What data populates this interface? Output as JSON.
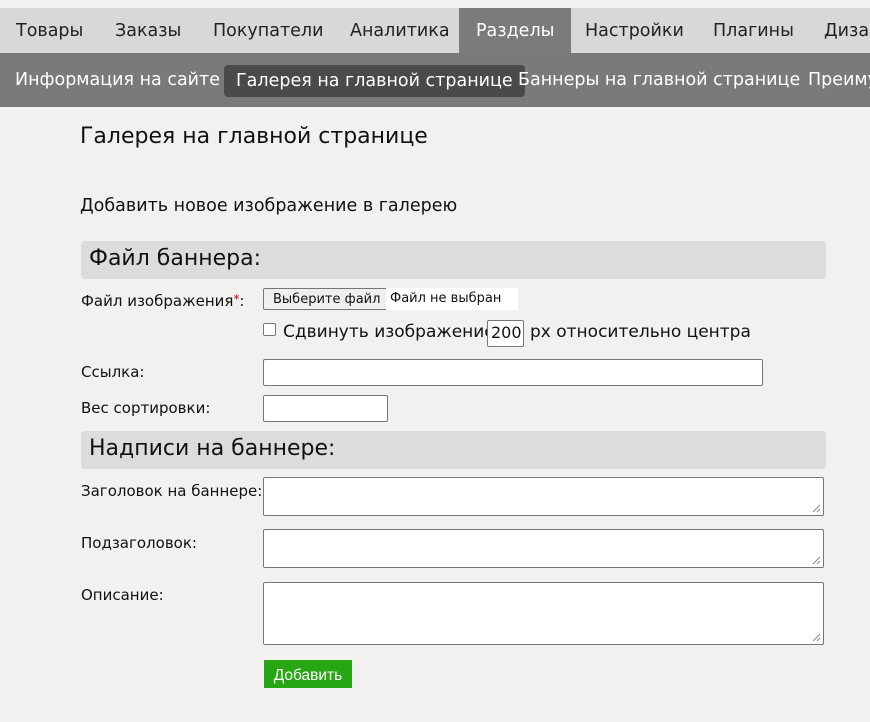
{
  "topnav": {
    "items": [
      "Товары",
      "Заказы",
      "Покупатели",
      "Аналитика",
      "Разделы",
      "Настройки",
      "Плагины",
      "Дизайн"
    ],
    "active": "Разделы"
  },
  "subnav": {
    "items": [
      "Информация на сайте",
      "Галерея на главной странице",
      "Баннеры на главной странице",
      "Преимущества"
    ],
    "active": "Галерея на главной странице"
  },
  "page": {
    "title": "Галерея на главной странице",
    "subtitle": "Добавить новое изображение в галерею"
  },
  "sections": {
    "file": "Файл баннера:",
    "captions": "Надписи на баннере:"
  },
  "form": {
    "file_label": "Файл изображения",
    "required_mark": "*",
    "file_colon": ":",
    "file_button": "Выберите файл",
    "file_status": "Файл не выбран",
    "shift_label": "Сдвинуть изображение на",
    "shift_value": "200",
    "shift_after": "px относительно центра",
    "link_label": "Ссылка:",
    "link_value": "",
    "sort_label": "Вес сортировки:",
    "sort_value": "",
    "heading_label": "Заголовок на баннере:",
    "subheading_label": "Подзаголовок:",
    "description_label": "Описание:",
    "submit": "Добавить"
  },
  "colors": {
    "topnav_bg": "#d8d8d8",
    "subnav_bg": "#7a7a7a",
    "active_tab_bg": "#7b7b7b",
    "submit_bg": "#27a713",
    "required": "#dd0000"
  }
}
